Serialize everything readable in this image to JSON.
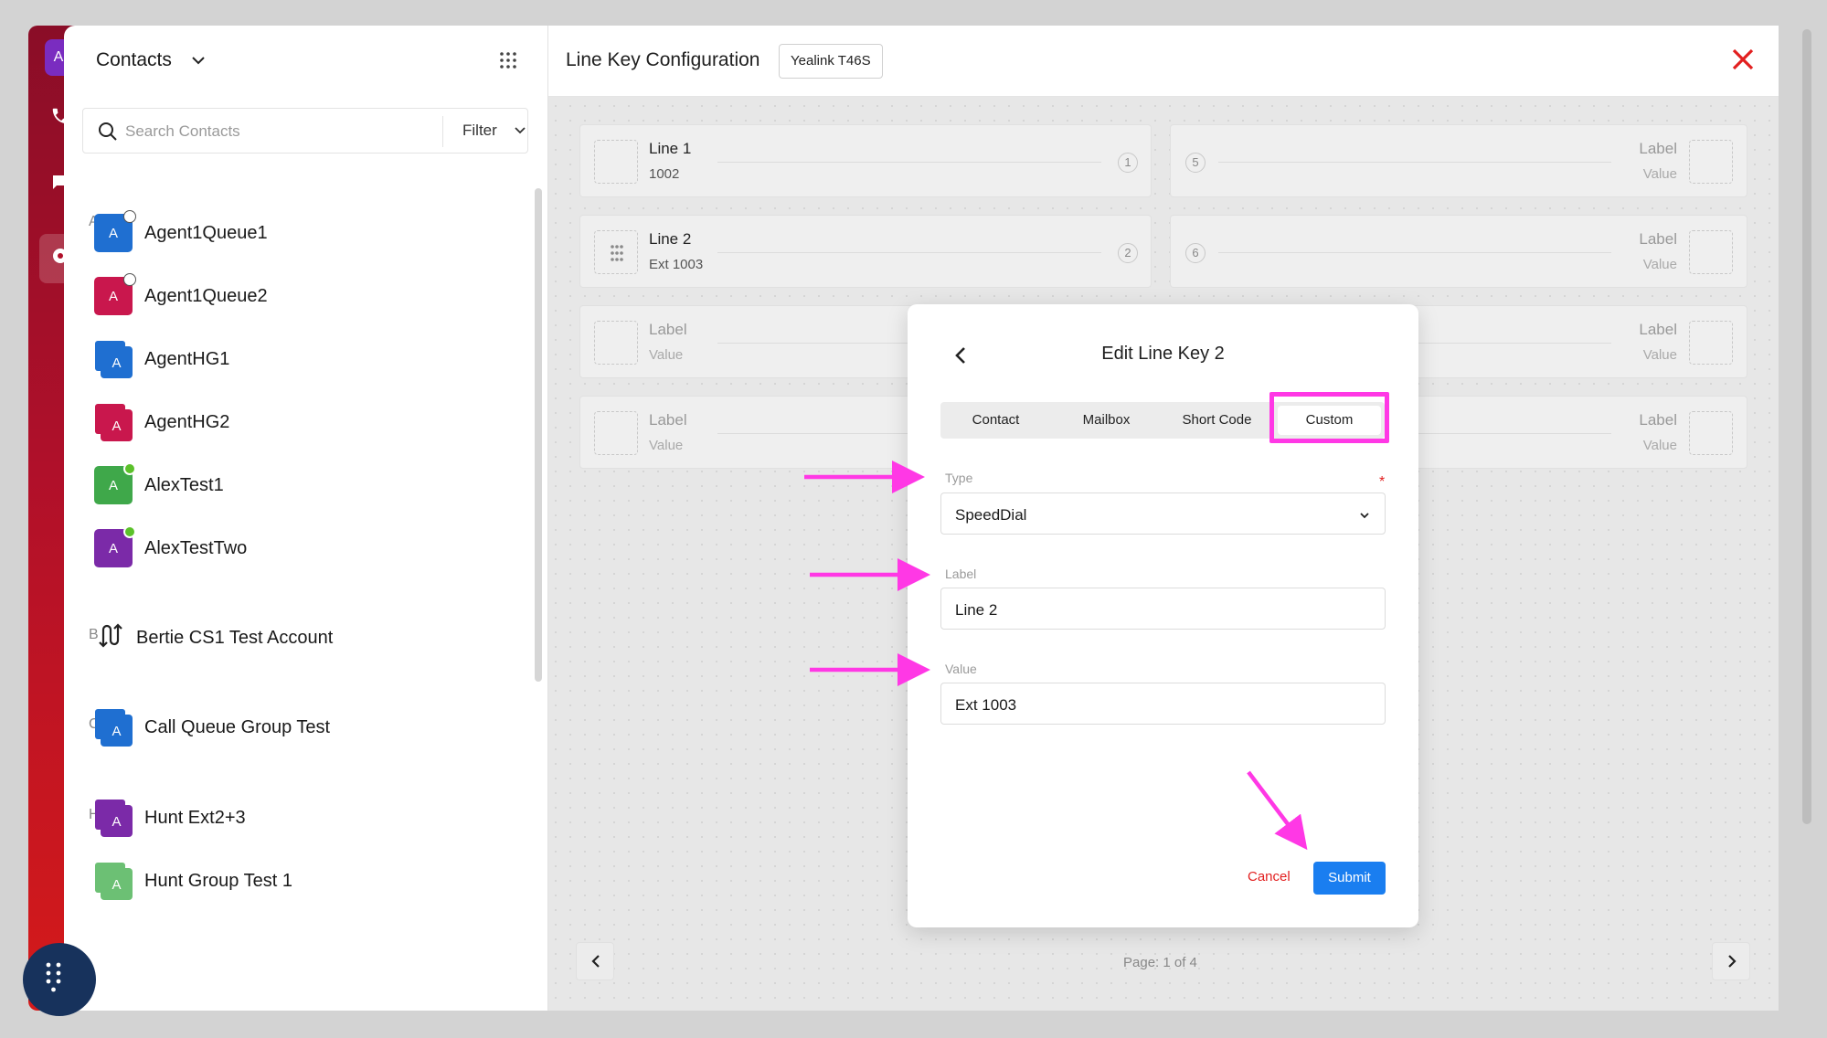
{
  "rail": {
    "avatar_letter": "A"
  },
  "contacts": {
    "title": "Contacts",
    "search_placeholder": "Search Contacts",
    "filter_label": "Filter",
    "sections": [
      {
        "letter": "A",
        "items": [
          {
            "initial": "A",
            "name": "Agent1Queue1",
            "color": "#1f6fd1",
            "status": "dnd"
          },
          {
            "initial": "A",
            "name": "Agent1Queue2",
            "color": "#c9174d",
            "status": "dnd"
          },
          {
            "initial": "A",
            "name": "AgentHG1",
            "color": "#1f6fd1",
            "status": "group"
          },
          {
            "initial": "A",
            "name": "AgentHG2",
            "color": "#c9174d",
            "status": "group"
          },
          {
            "initial": "A",
            "name": "AlexTest1",
            "color": "#3fa84a",
            "status": "online"
          },
          {
            "initial": "A",
            "name": "AlexTestTwo",
            "color": "#7b2aa8",
            "status": "online"
          }
        ]
      },
      {
        "letter": "B",
        "items": [
          {
            "initial": "",
            "name": "Bertie CS1 Test Account",
            "color": "",
            "status": "route"
          }
        ]
      },
      {
        "letter": "C",
        "items": [
          {
            "initial": "A",
            "name": "Call Queue Group Test",
            "color": "#1f6fd1",
            "status": "group"
          }
        ]
      },
      {
        "letter": "H",
        "items": [
          {
            "initial": "A",
            "name": "Hunt Ext2+3",
            "color": "#7b2aa8",
            "status": "group"
          },
          {
            "initial": "A",
            "name": "Hunt Group Test 1",
            "color": "#6cc074",
            "status": "group"
          }
        ]
      }
    ]
  },
  "main": {
    "title": "Line Key Configuration",
    "device_model": "Yealink T46S",
    "pager": "Page: 1 of 4",
    "left_keys": [
      {
        "label": "Line 1",
        "value": "1002",
        "number": "1",
        "active": true
      },
      {
        "label": "Line 2",
        "value": "Ext 1003",
        "number": "2",
        "active": true
      },
      {
        "label": "Label",
        "value": "Value",
        "number": "",
        "active": false
      },
      {
        "label": "Label",
        "value": "Value",
        "number": "",
        "active": false
      }
    ],
    "right_keys": [
      {
        "label": "Label",
        "value": "Value",
        "number": "5"
      },
      {
        "label": "Label",
        "value": "Value",
        "number": "6"
      },
      {
        "label": "Label",
        "value": "Value",
        "number": ""
      },
      {
        "label": "Label",
        "value": "Value",
        "number": ""
      }
    ]
  },
  "modal": {
    "title": "Edit Line Key 2",
    "tabs": [
      "Contact",
      "Mailbox",
      "Short Code",
      "Custom"
    ],
    "selected_tab": "Custom",
    "type_label": "Type",
    "type_value": "SpeedDial",
    "label_label": "Label",
    "label_value": "Line 2",
    "value_label": "Value",
    "value_value": "Ext 1003",
    "cancel_label": "Cancel",
    "submit_label": "Submit",
    "required_mark": "*"
  },
  "colors": {
    "accent": "#1a7ef0",
    "annotation": "#ff38e5",
    "danger": "#e21f1f"
  }
}
